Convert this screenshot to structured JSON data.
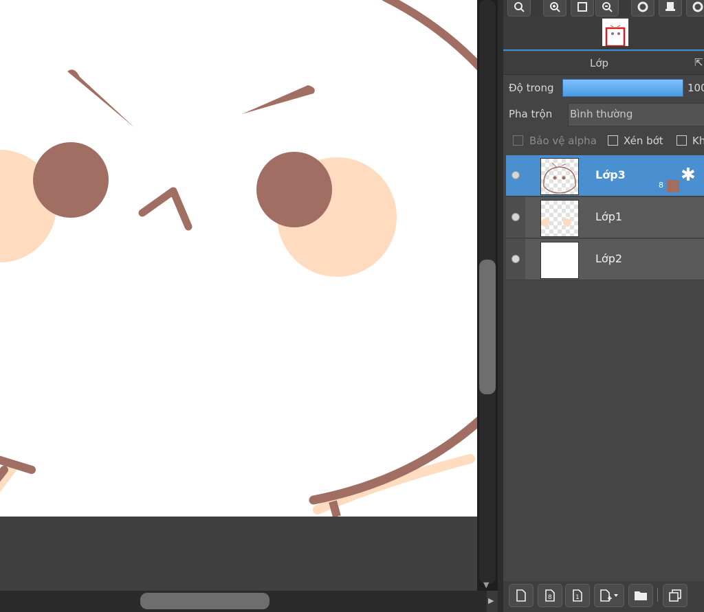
{
  "panel": {
    "title": "Lớp",
    "opacity_label": "Độ trong",
    "opacity_value": "100",
    "opacity_fraction": 1.0,
    "blend_label": "Pha trộn",
    "blend_value": "Bình thường",
    "checkbox_alpha": "Bảo vệ alpha",
    "checkbox_clip": "Xén bớt",
    "checkbox_lock": "Kh"
  },
  "layers": [
    {
      "name": "Lớp3",
      "active": true,
      "badge_number": "8",
      "badge_color": "#a16e64"
    },
    {
      "name": "Lớp1",
      "active": false
    },
    {
      "name": "Lớp2",
      "active": false
    }
  ],
  "colors": {
    "accent": "#4a8fd0",
    "stroke_brown": "#a16e64",
    "blush": "#ffdbc0",
    "canvas": "#ffffff"
  },
  "icons": {
    "toolbar": [
      "zoom-fit-icon",
      "zoom-in-icon",
      "fit-screen-icon",
      "zoom-out-icon",
      "rotate-icon",
      "flip-icon",
      "settings-icon"
    ],
    "bottom": [
      "new-layer-icon",
      "new-8bit-layer-icon",
      "new-1bit-layer-icon",
      "add-layer-menu-icon",
      "new-folder-icon",
      "duplicate-layer-icon"
    ]
  }
}
